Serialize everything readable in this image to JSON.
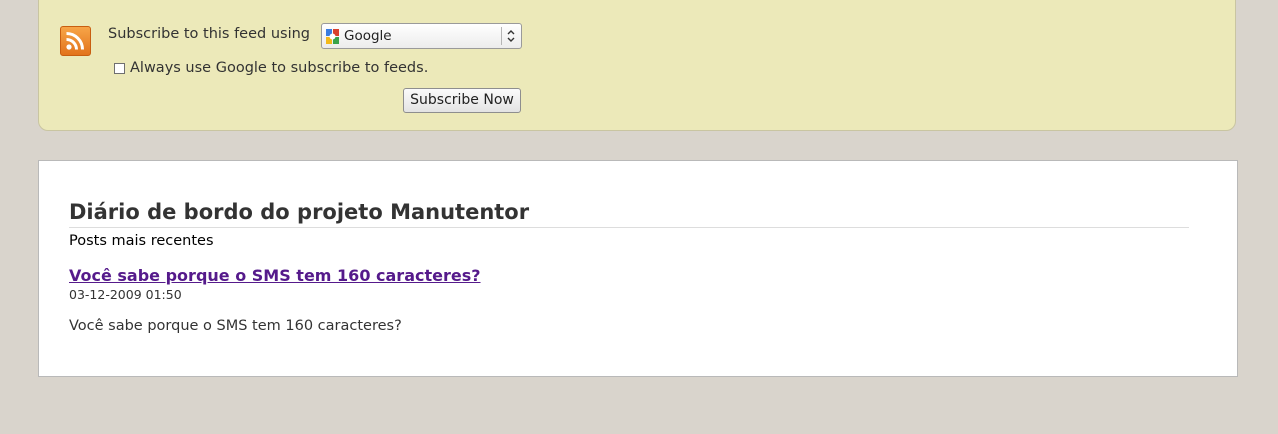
{
  "subscribe": {
    "label": "Subscribe to this feed using",
    "reader_selected": "Google",
    "always_label": "Always use Google to subscribe to feeds.",
    "always_checked": false,
    "button_label": "Subscribe Now"
  },
  "feed": {
    "title": "Diário de bordo do projeto Manutentor",
    "subtitle": "Posts mais recentes",
    "posts": [
      {
        "title": "Você sabe porque o SMS tem 160 caracteres?",
        "date": "03-12-2009 01:50",
        "summary": "Você sabe porque o SMS tem 160 caracteres?"
      }
    ]
  },
  "colors": {
    "page_background": "#d9d4cc",
    "subscribe_box": "#ece9b9",
    "rss_orange": "#f0882c",
    "visited_link": "#551a8b"
  }
}
